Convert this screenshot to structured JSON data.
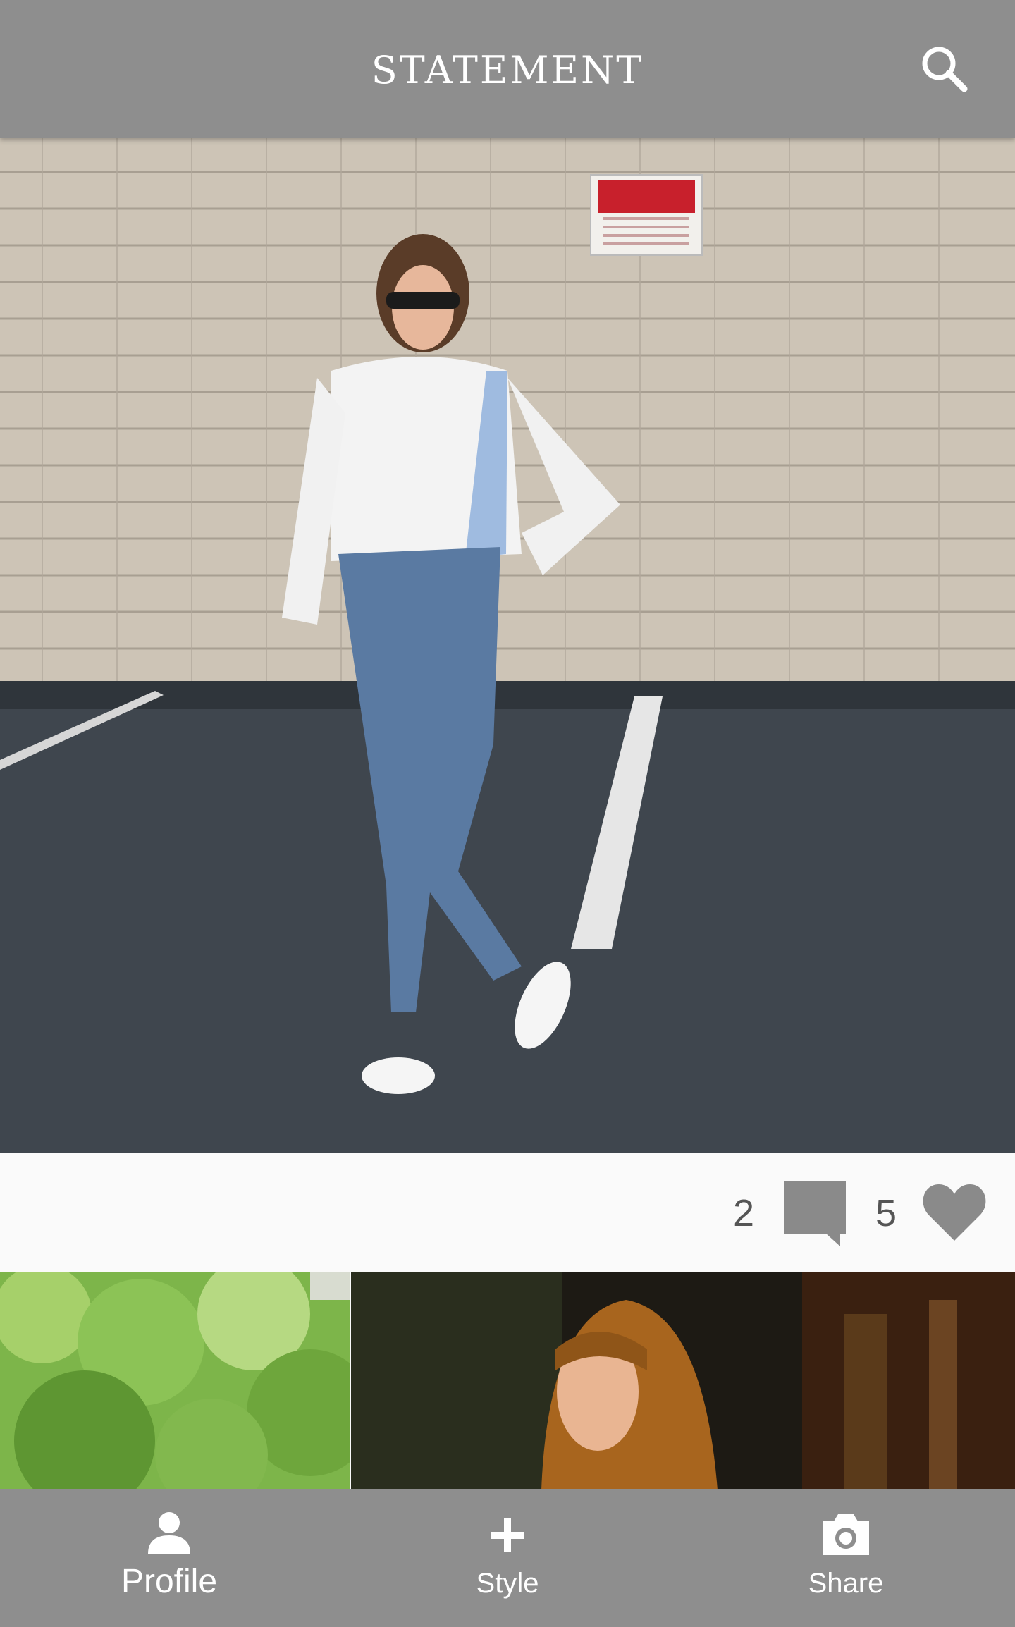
{
  "header": {
    "title": "STATEMENT",
    "search_icon": "search-icon"
  },
  "post": {
    "comment_count": "2",
    "like_count": "5",
    "comment_icon": "comment-icon",
    "like_icon": "heart-icon"
  },
  "bottom_nav": {
    "items": [
      {
        "label": "Profile",
        "icon": "person-icon"
      },
      {
        "label": "Style",
        "icon": "plus-icon"
      },
      {
        "label": "Share",
        "icon": "camera-icon"
      }
    ]
  },
  "colors": {
    "bar": "#8e8e8e",
    "background": "#fafafa",
    "icon_gray": "#8a8a8a"
  }
}
